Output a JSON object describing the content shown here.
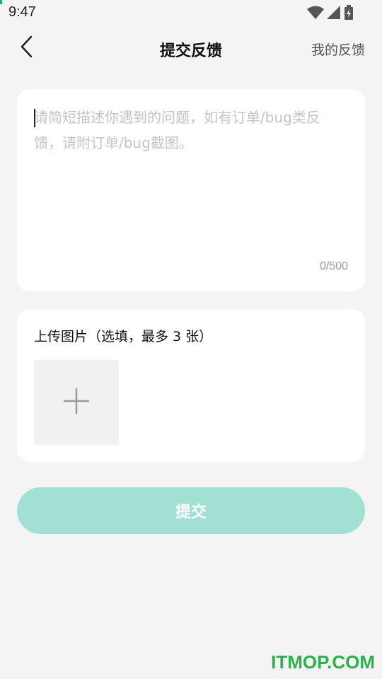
{
  "status_bar": {
    "time": "9:47",
    "icons": [
      "wifi-icon",
      "cellular-signal-icon",
      "battery-icon"
    ]
  },
  "header": {
    "back_icon": "chevron-left-icon",
    "title": "提交反馈",
    "my_feedback": "我的反馈"
  },
  "description": {
    "value": "",
    "placeholder": "请简短描述你遇到的问题，如有订单/bug类反馈，请附订单/bug截图。",
    "counter": "0/500"
  },
  "upload": {
    "label": "上传图片（选填，最多 3 张）",
    "add_icon": "plus-icon"
  },
  "submit": {
    "label": "提交",
    "color": "#a3e0d4"
  },
  "watermark": "ITMOP.COM"
}
